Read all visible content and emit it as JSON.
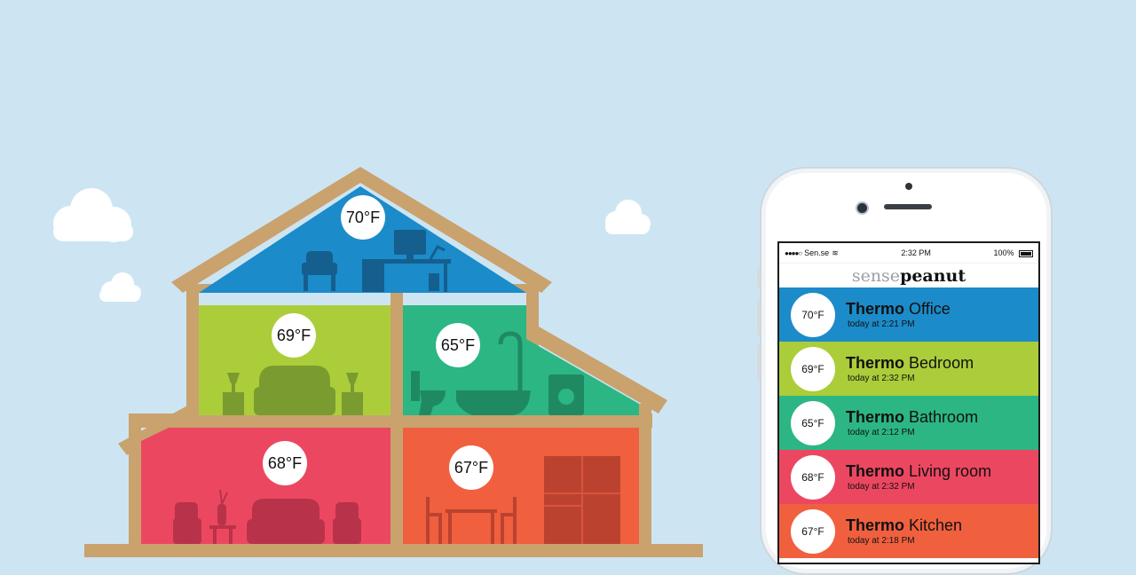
{
  "colors": {
    "sky": "#cde5f3",
    "wood": "#c9a26e",
    "office": "#1c8bc9",
    "bedroom": "#abcd3a",
    "bathroom": "#2cb684",
    "living": "#ec4761",
    "kitchen": "#f0603f"
  },
  "house": {
    "rooms": [
      {
        "key": "office",
        "temp": "70°F"
      },
      {
        "key": "bedroom",
        "temp": "69°F"
      },
      {
        "key": "bathroom",
        "temp": "65°F"
      },
      {
        "key": "living",
        "temp": "68°F"
      },
      {
        "key": "kitchen",
        "temp": "67°F"
      }
    ]
  },
  "phone": {
    "status": {
      "carrier": "Sen.se",
      "time": "2:32 PM",
      "battery": "100%"
    },
    "brand": {
      "part1": "sense",
      "part2": "peanut"
    },
    "rooms": [
      {
        "temp": "70°F",
        "device": "Thermo",
        "room": "Office",
        "updated": "today at 2:21 PM",
        "color": "#1c8bc9"
      },
      {
        "temp": "69°F",
        "device": "Thermo",
        "room": "Bedroom",
        "updated": "today at 2:32 PM",
        "color": "#abcd3a"
      },
      {
        "temp": "65°F",
        "device": "Thermo",
        "room": "Bathroom",
        "updated": "today at 2:12 PM",
        "color": "#2cb684"
      },
      {
        "temp": "68°F",
        "device": "Thermo",
        "room": "Living room",
        "updated": "today at 2:32 PM",
        "color": "#ec4761"
      },
      {
        "temp": "67°F",
        "device": "Thermo",
        "room": "Kitchen",
        "updated": "today at 2:18 PM",
        "color": "#f0603f"
      }
    ]
  }
}
